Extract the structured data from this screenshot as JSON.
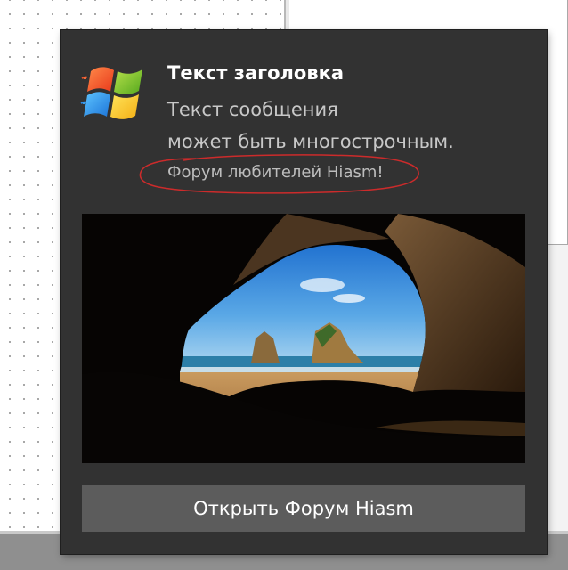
{
  "toast": {
    "title": "Текст заголовка",
    "message_line1": "Текст сообщения",
    "message_line2": "может быть многострочным.",
    "attribution": "Форум любителей Hiasm!",
    "action_label": "Открыть Форум Hiasm",
    "logo_icon": "windows-flag-icon",
    "background_color": "#323232",
    "button_color": "#5c5c5c",
    "highlight_color": "#cc2b2b"
  }
}
